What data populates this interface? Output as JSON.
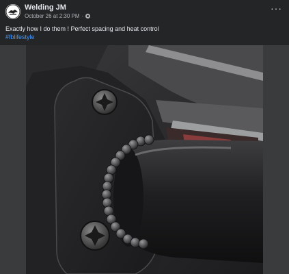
{
  "post": {
    "author": "Welding JM",
    "timestamp": "October 26 at 2:30 PM",
    "separator": "·",
    "privacy_icon": "globe-icon",
    "more_icon": "more-options-icon",
    "more_label": "···",
    "caption": "Exactly how I do them ! Perfect spacing and heat control",
    "hashtag": "#fblifestyle"
  },
  "colors": {
    "background": "#242526",
    "text_primary": "#e4e6eb",
    "text_secondary": "#b0b3b8",
    "link": "#4599ff"
  },
  "photo": {
    "subject": "weld-bead-photo"
  }
}
